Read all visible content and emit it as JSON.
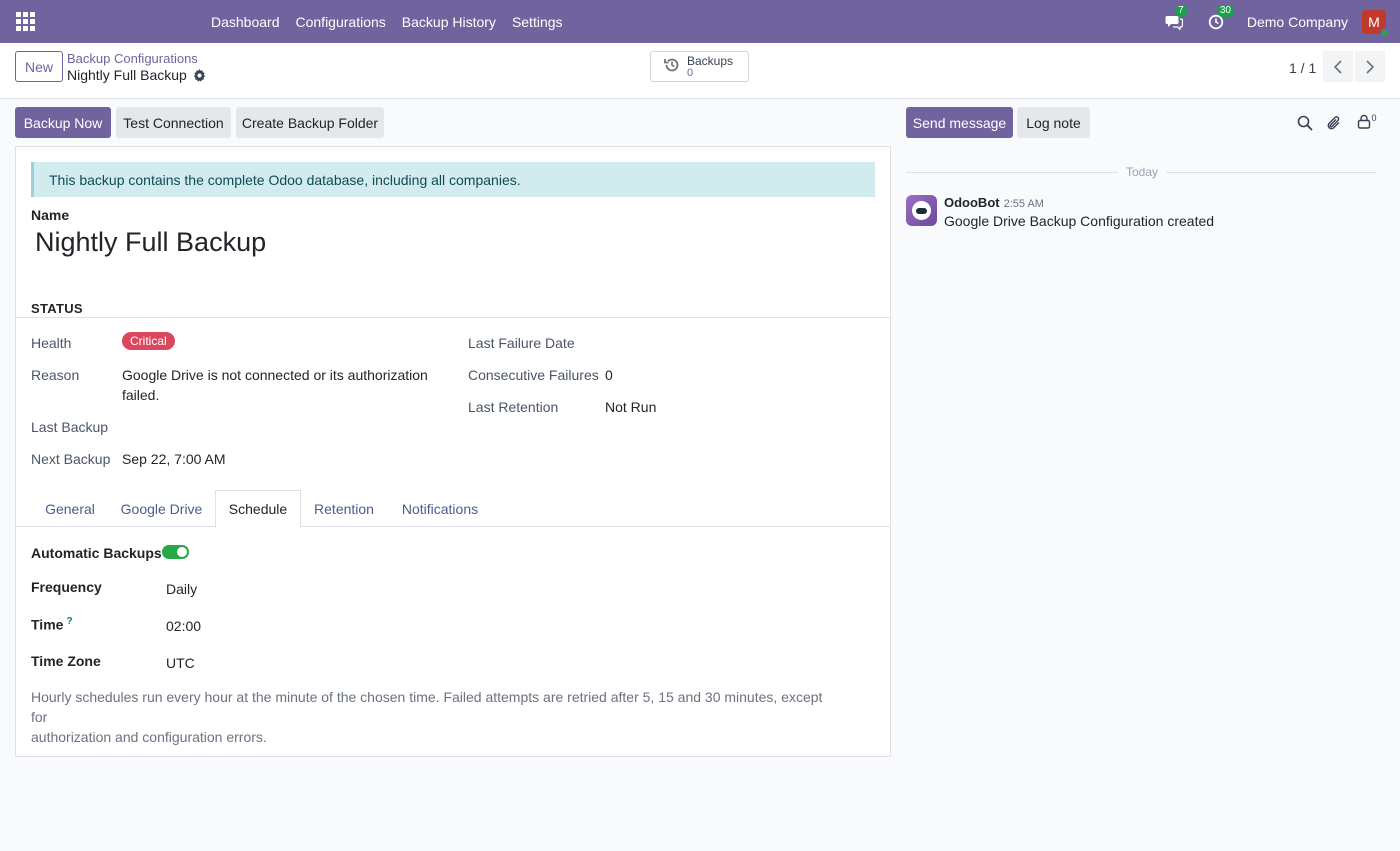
{
  "navbar": {
    "menu": [
      "Dashboard",
      "Configurations",
      "Backup History",
      "Settings"
    ],
    "messages_count": "7",
    "activities_count": "30",
    "company": "Demo Company",
    "user_initial": "M"
  },
  "control": {
    "new_label": "New",
    "breadcrumb_parent": "Backup Configurations",
    "breadcrumb_current": "Nightly Full Backup",
    "stat_label": "Backups",
    "stat_value": "0",
    "pager": "1 / 1"
  },
  "actions": {
    "backup_now": "Backup Now",
    "test_connection": "Test Connection",
    "create_folder": "Create Backup Folder"
  },
  "form": {
    "alert": "This backup contains the complete Odoo database, including all companies.",
    "name_label": "Name",
    "name_value": "Nightly Full Backup",
    "status_title": "STATUS",
    "health_label": "Health",
    "health_value": "Critical",
    "reason_label": "Reason",
    "reason_line1": "Google Drive is not connected or its authorization",
    "reason_line2": "failed.",
    "last_backup_label": "Last Backup",
    "last_backup_value": "",
    "next_backup_label": "Next Backup",
    "next_backup_value": "Sep 22, 7:00 AM",
    "last_failure_label": "Last Failure Date",
    "last_failure_value": "",
    "consecutive_label": "Consecutive Failures",
    "consecutive_value": "0",
    "last_retention_label": "Last Retention",
    "last_retention_value": "Not Run",
    "tabs": [
      "General",
      "Google Drive",
      "Schedule",
      "Retention",
      "Notifications"
    ],
    "active_tab": "Schedule",
    "schedule": {
      "auto_label": "Automatic Backups",
      "auto_enabled": true,
      "frequency_label": "Frequency",
      "frequency_value": "Daily",
      "time_label": "Time",
      "time_help": "?",
      "time_value": "02:00",
      "tz_label": "Time Zone",
      "tz_value": "UTC",
      "note_line1": "Hourly schedules run every hour at the minute of the chosen time. Failed attempts are retried after 5, 15 and 30 minutes, except for",
      "note_line2": "authorization and configuration errors."
    }
  },
  "chatter": {
    "send_message": "Send message",
    "log_note": "Log note",
    "followers_count": "0",
    "date_separator": "Today",
    "author": "OdooBot",
    "time": "2:55 AM",
    "body": "Google Drive Backup Configuration created"
  },
  "colors": {
    "brand": "#71639e",
    "critical": "#d9485f",
    "success": "#28a745",
    "alert_bg": "#d2ebee"
  }
}
